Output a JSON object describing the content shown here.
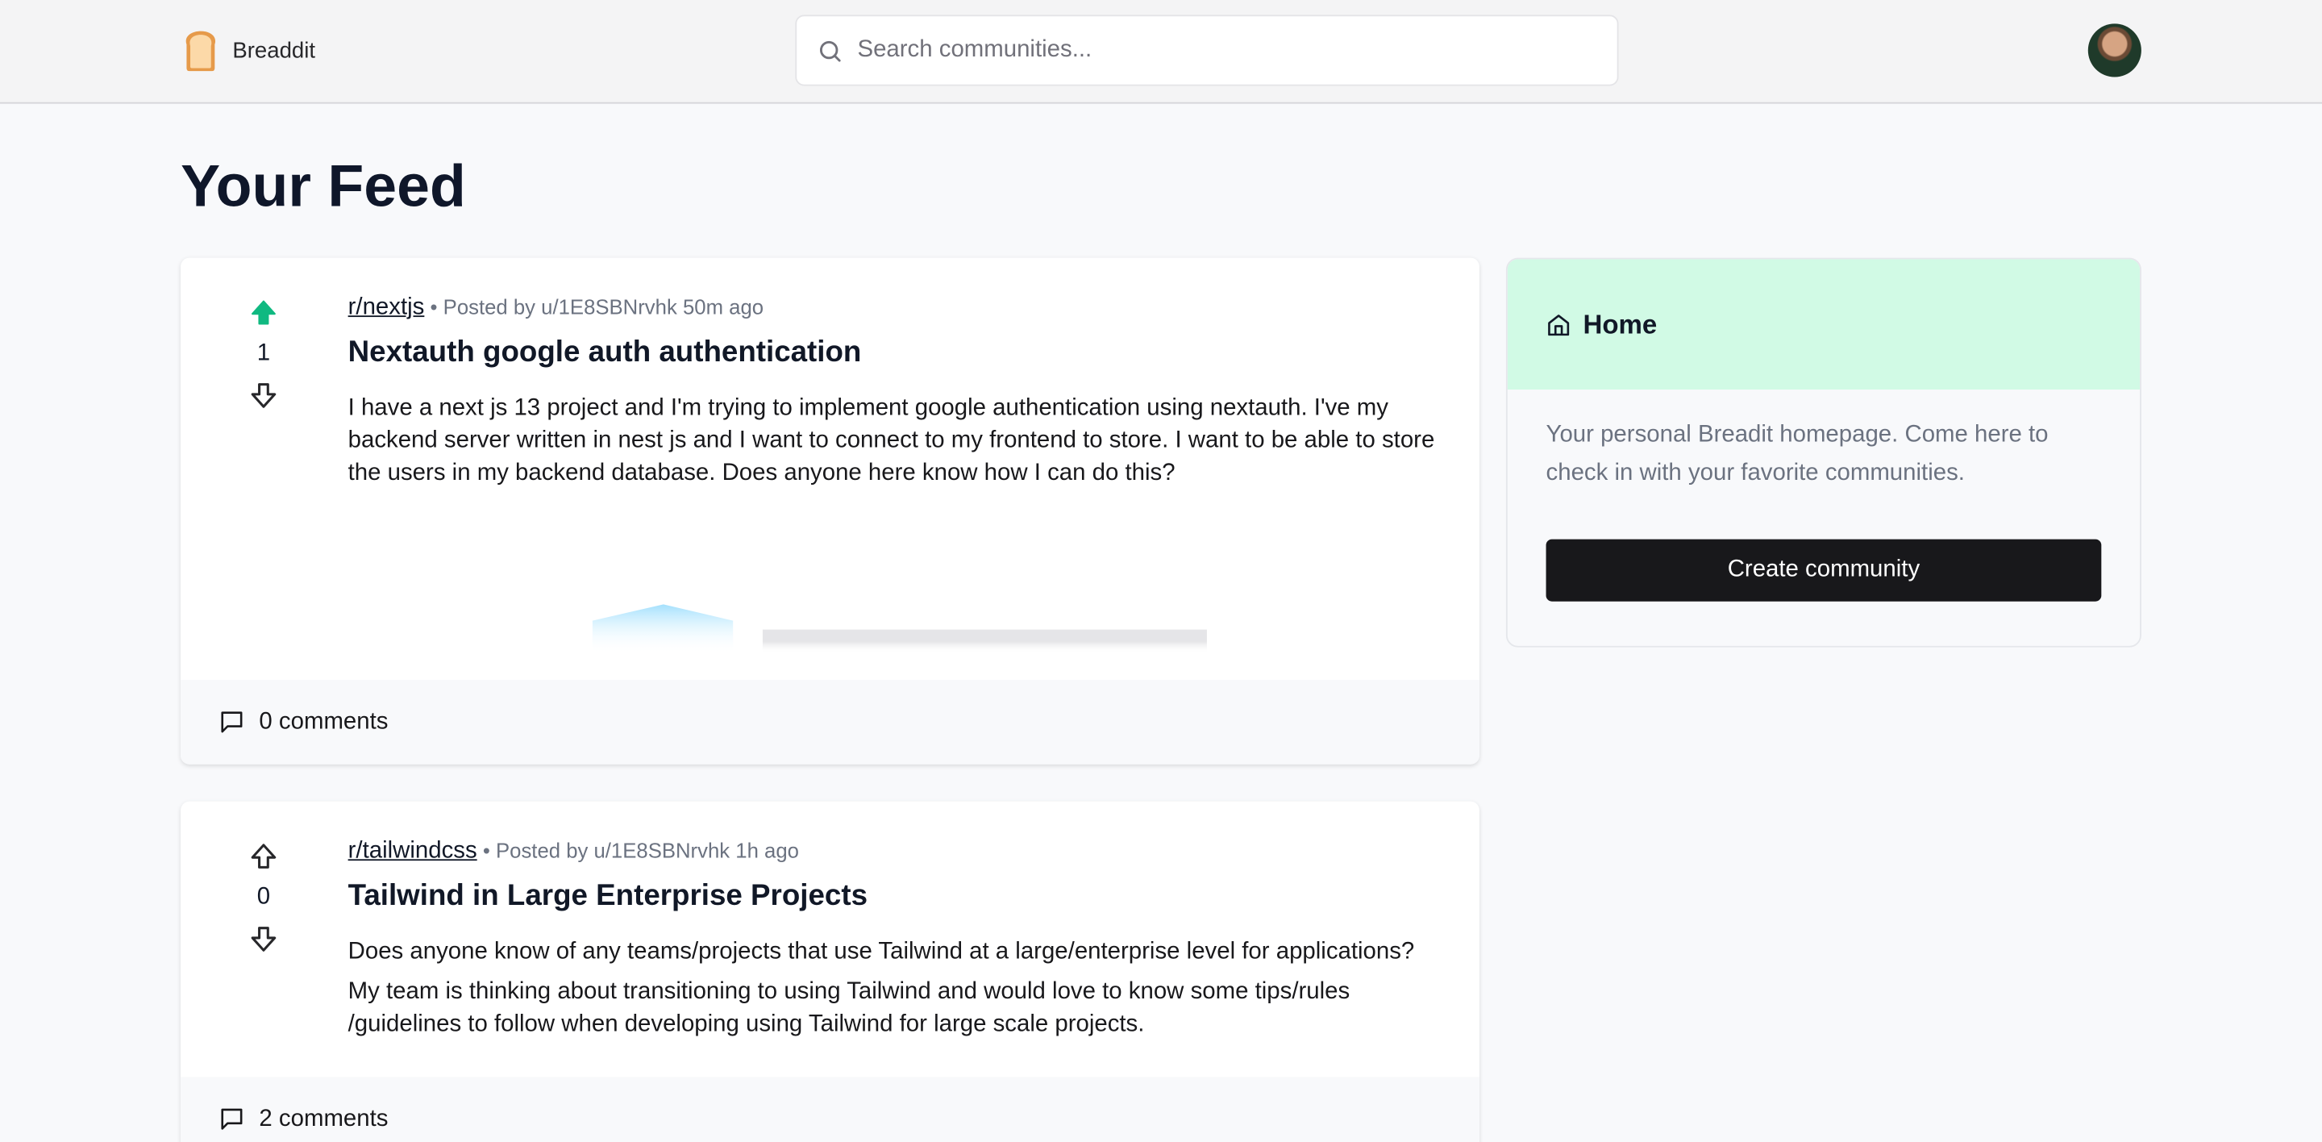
{
  "app": {
    "name": "Breaddit"
  },
  "search": {
    "placeholder": "Search communities..."
  },
  "feed": {
    "title": "Your Feed"
  },
  "posts": [
    {
      "subreddit": "r/nextjs",
      "separator": "•",
      "posted_by": "Posted by u/1E8SBNrvhk",
      "time": "50m ago",
      "votes": "1",
      "upvoted": true,
      "title": "Nextauth google auth authentication",
      "body": "I have a next js 13 project and I'm trying to implement google authentication using nextauth. I've my backend server written in nest js and I want to connect to my frontend to store. I want to be able to store the users in my backend database. Does anyone here know how I can do this?",
      "comments": "0 comments"
    },
    {
      "subreddit": "r/tailwindcss",
      "separator": "•",
      "posted_by": "Posted by u/1E8SBNrvhk",
      "time": "1h ago",
      "votes": "0",
      "upvoted": false,
      "title": "Tailwind in Large Enterprise Projects",
      "body_lines": [
        "Does anyone know of any teams/projects that use Tailwind at a large/enterprise level for applications?",
        "My team is thinking about transitioning to using Tailwind and would love to know some tips/rules /guidelines to follow when developing using Tailwind for large scale projects."
      ],
      "comments": "2 comments"
    }
  ],
  "sidebar": {
    "title": "Home",
    "description": "Your personal Breadit homepage. Come here to check in with your favorite communities.",
    "create_label": "Create community"
  },
  "colors": {
    "upvote": "#10b981",
    "home_bg": "#d1fae5",
    "button": "#18181b"
  },
  "icons": [
    "bread-logo-icon",
    "search-icon",
    "avatar",
    "arrow-up-icon",
    "arrow-down-icon",
    "comment-icon",
    "home-icon"
  ]
}
